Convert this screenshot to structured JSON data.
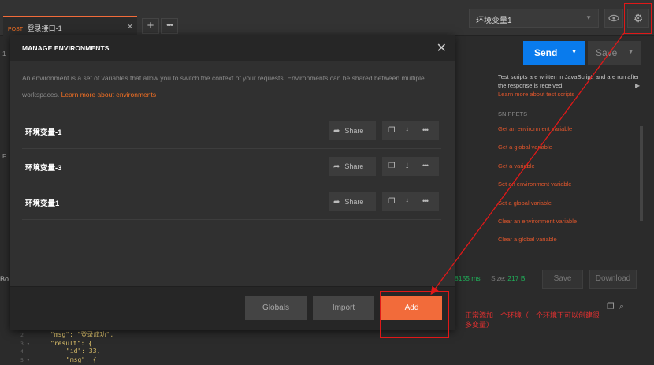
{
  "tab": {
    "method": "POST",
    "title": "登录接口-1",
    "close": "×",
    "plus": "+",
    "more": "•••"
  },
  "env_selector": {
    "selected": "环境变量1",
    "caret": "▼"
  },
  "toolbar": {
    "send_label": "Send",
    "save_label": "Save",
    "caret": "▼"
  },
  "scripts_panel": {
    "help_text": "Test scripts are written in JavaScript, and are run after the response is received.",
    "learn_link": "Learn more about test scripts",
    "snippets_heading": "SNIPPETS",
    "snippets": [
      "Get an environment variable",
      "Get a global variable",
      "Get a variable",
      "Set an environment variable",
      "Set a global variable",
      "Clear an environment variable",
      "Clear a global variable"
    ]
  },
  "response": {
    "time": "8155 ms",
    "size_label": "Size:",
    "size_value": "217 B",
    "save_label": "Save",
    "download_label": "Download"
  },
  "body_label": "Bo",
  "code_lines": [
    {
      "ln": "2",
      "text": "\"msg\": \"登录成功\","
    },
    {
      "ln": "3 ▾",
      "text": "\"result\": {"
    },
    {
      "ln": "4",
      "text": "\"id\": 33,"
    },
    {
      "ln": "5 ▾",
      "text": "\"msg\": {"
    }
  ],
  "modal": {
    "title": "MANAGE ENVIRONMENTS",
    "close": "✕",
    "description": "An environment is a set of variables that allow you to switch the context of your requests. Environments can be shared between multiple workspaces.",
    "learn_link": "Learn more about environments",
    "environments": [
      {
        "name": "环境变量-1",
        "share_label": "Share"
      },
      {
        "name": "环境变量-3",
        "share_label": "Share"
      },
      {
        "name": "环境变量1",
        "share_label": "Share"
      }
    ],
    "footer": {
      "globals_label": "Globals",
      "import_label": "Import",
      "add_label": "Add"
    }
  },
  "annotation": {
    "text": "正常添加一个环境（一个环境下可以创建很多变量）",
    "color": "#e01818"
  },
  "colors": {
    "accent": "#f26b3a",
    "send": "#097bed",
    "success": "#1fb25a"
  }
}
